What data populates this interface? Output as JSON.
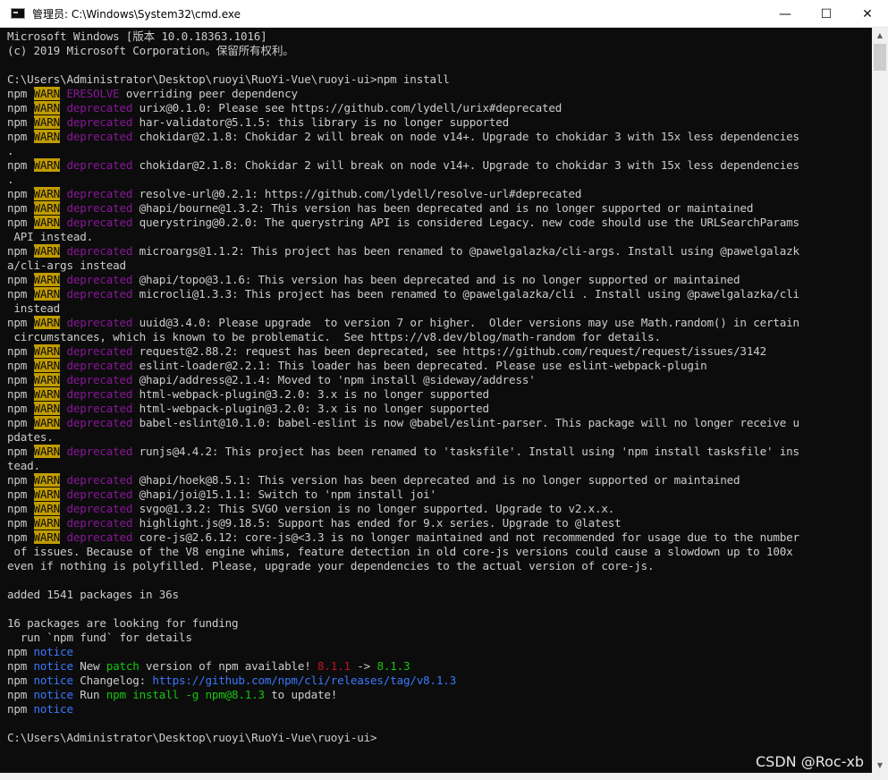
{
  "window": {
    "title": "管理员: C:\\Windows\\System32\\cmd.exe",
    "minimize": "—",
    "maximize": "☐",
    "close": "✕"
  },
  "watermark": "CSDN @Roc-xb",
  "console_lines": [
    [
      {
        "t": "Microsoft Windows [版本 10.0.18363.1016]"
      }
    ],
    [
      {
        "t": "(c) 2019 Microsoft Corporation。保留所有权利。"
      }
    ],
    [
      {
        "t": ""
      }
    ],
    [
      {
        "t": "C:\\Users\\Administrator\\Desktop\\ruoyi\\RuoYi-Vue\\ruoyi-ui>npm install"
      }
    ],
    [
      {
        "t": "npm "
      },
      {
        "t": "WARN",
        "c": "warn"
      },
      {
        "t": " "
      },
      {
        "t": "ERESOLVE",
        "c": "mag"
      },
      {
        "t": " overriding peer dependency"
      }
    ],
    [
      {
        "t": "npm "
      },
      {
        "t": "WARN",
        "c": "warn"
      },
      {
        "t": " "
      },
      {
        "t": "deprecated",
        "c": "mag"
      },
      {
        "t": " urix@0.1.0: Please see https://github.com/lydell/urix#deprecated"
      }
    ],
    [
      {
        "t": "npm "
      },
      {
        "t": "WARN",
        "c": "warn"
      },
      {
        "t": " "
      },
      {
        "t": "deprecated",
        "c": "mag"
      },
      {
        "t": " har-validator@5.1.5: this library is no longer supported"
      }
    ],
    [
      {
        "t": "npm "
      },
      {
        "t": "WARN",
        "c": "warn"
      },
      {
        "t": " "
      },
      {
        "t": "deprecated",
        "c": "mag"
      },
      {
        "t": " chokidar@2.1.8: Chokidar 2 will break on node v14+. Upgrade to chokidar 3 with 15x less dependencies"
      }
    ],
    [
      {
        "t": "."
      }
    ],
    [
      {
        "t": "npm "
      },
      {
        "t": "WARN",
        "c": "warn"
      },
      {
        "t": " "
      },
      {
        "t": "deprecated",
        "c": "mag"
      },
      {
        "t": " chokidar@2.1.8: Chokidar 2 will break on node v14+. Upgrade to chokidar 3 with 15x less dependencies"
      }
    ],
    [
      {
        "t": "."
      }
    ],
    [
      {
        "t": "npm "
      },
      {
        "t": "WARN",
        "c": "warn"
      },
      {
        "t": " "
      },
      {
        "t": "deprecated",
        "c": "mag"
      },
      {
        "t": " resolve-url@0.2.1: https://github.com/lydell/resolve-url#deprecated"
      }
    ],
    [
      {
        "t": "npm "
      },
      {
        "t": "WARN",
        "c": "warn"
      },
      {
        "t": " "
      },
      {
        "t": "deprecated",
        "c": "mag"
      },
      {
        "t": " @hapi/bourne@1.3.2: This version has been deprecated and is no longer supported or maintained"
      }
    ],
    [
      {
        "t": "npm "
      },
      {
        "t": "WARN",
        "c": "warn"
      },
      {
        "t": " "
      },
      {
        "t": "deprecated",
        "c": "mag"
      },
      {
        "t": " querystring@0.2.0: The querystring API is considered Legacy. new code should use the URLSearchParams"
      }
    ],
    [
      {
        "t": " API instead."
      }
    ],
    [
      {
        "t": "npm "
      },
      {
        "t": "WARN",
        "c": "warn"
      },
      {
        "t": " "
      },
      {
        "t": "deprecated",
        "c": "mag"
      },
      {
        "t": " microargs@1.1.2: This project has been renamed to @pawelgalazka/cli-args. Install using @pawelgalazk"
      }
    ],
    [
      {
        "t": "a/cli-args instead"
      }
    ],
    [
      {
        "t": "npm "
      },
      {
        "t": "WARN",
        "c": "warn"
      },
      {
        "t": " "
      },
      {
        "t": "deprecated",
        "c": "mag"
      },
      {
        "t": " @hapi/topo@3.1.6: This version has been deprecated and is no longer supported or maintained"
      }
    ],
    [
      {
        "t": "npm "
      },
      {
        "t": "WARN",
        "c": "warn"
      },
      {
        "t": " "
      },
      {
        "t": "deprecated",
        "c": "mag"
      },
      {
        "t": " microcli@1.3.3: This project has been renamed to @pawelgalazka/cli . Install using @pawelgalazka/cli"
      }
    ],
    [
      {
        "t": " instead"
      }
    ],
    [
      {
        "t": "npm "
      },
      {
        "t": "WARN",
        "c": "warn"
      },
      {
        "t": " "
      },
      {
        "t": "deprecated",
        "c": "mag"
      },
      {
        "t": " uuid@3.4.0: Please upgrade  to version 7 or higher.  Older versions may use Math.random() in certain"
      }
    ],
    [
      {
        "t": " circumstances, which is known to be problematic.  See https://v8.dev/blog/math-random for details."
      }
    ],
    [
      {
        "t": "npm "
      },
      {
        "t": "WARN",
        "c": "warn"
      },
      {
        "t": " "
      },
      {
        "t": "deprecated",
        "c": "mag"
      },
      {
        "t": " request@2.88.2: request has been deprecated, see https://github.com/request/request/issues/3142"
      }
    ],
    [
      {
        "t": "npm "
      },
      {
        "t": "WARN",
        "c": "warn"
      },
      {
        "t": " "
      },
      {
        "t": "deprecated",
        "c": "mag"
      },
      {
        "t": " eslint-loader@2.2.1: This loader has been deprecated. Please use eslint-webpack-plugin"
      }
    ],
    [
      {
        "t": "npm "
      },
      {
        "t": "WARN",
        "c": "warn"
      },
      {
        "t": " "
      },
      {
        "t": "deprecated",
        "c": "mag"
      },
      {
        "t": " @hapi/address@2.1.4: Moved to 'npm install @sideway/address'"
      }
    ],
    [
      {
        "t": "npm "
      },
      {
        "t": "WARN",
        "c": "warn"
      },
      {
        "t": " "
      },
      {
        "t": "deprecated",
        "c": "mag"
      },
      {
        "t": " html-webpack-plugin@3.2.0: 3.x is no longer supported"
      }
    ],
    [
      {
        "t": "npm "
      },
      {
        "t": "WARN",
        "c": "warn"
      },
      {
        "t": " "
      },
      {
        "t": "deprecated",
        "c": "mag"
      },
      {
        "t": " html-webpack-plugin@3.2.0: 3.x is no longer supported"
      }
    ],
    [
      {
        "t": "npm "
      },
      {
        "t": "WARN",
        "c": "warn"
      },
      {
        "t": " "
      },
      {
        "t": "deprecated",
        "c": "mag"
      },
      {
        "t": " babel-eslint@10.1.0: babel-eslint is now @babel/eslint-parser. This package will no longer receive u"
      }
    ],
    [
      {
        "t": "pdates."
      }
    ],
    [
      {
        "t": "npm "
      },
      {
        "t": "WARN",
        "c": "warn"
      },
      {
        "t": " "
      },
      {
        "t": "deprecated",
        "c": "mag"
      },
      {
        "t": " runjs@4.4.2: This project has been renamed to 'tasksfile'. Install using 'npm install tasksfile' ins"
      }
    ],
    [
      {
        "t": "tead."
      }
    ],
    [
      {
        "t": "npm "
      },
      {
        "t": "WARN",
        "c": "warn"
      },
      {
        "t": " "
      },
      {
        "t": "deprecated",
        "c": "mag"
      },
      {
        "t": " @hapi/hoek@8.5.1: This version has been deprecated and is no longer supported or maintained"
      }
    ],
    [
      {
        "t": "npm "
      },
      {
        "t": "WARN",
        "c": "warn"
      },
      {
        "t": " "
      },
      {
        "t": "deprecated",
        "c": "mag"
      },
      {
        "t": " @hapi/joi@15.1.1: Switch to 'npm install joi'"
      }
    ],
    [
      {
        "t": "npm "
      },
      {
        "t": "WARN",
        "c": "warn"
      },
      {
        "t": " "
      },
      {
        "t": "deprecated",
        "c": "mag"
      },
      {
        "t": " svgo@1.3.2: This SVGO version is no longer supported. Upgrade to v2.x.x."
      }
    ],
    [
      {
        "t": "npm "
      },
      {
        "t": "WARN",
        "c": "warn"
      },
      {
        "t": " "
      },
      {
        "t": "deprecated",
        "c": "mag"
      },
      {
        "t": " highlight.js@9.18.5: Support has ended for 9.x series. Upgrade to @latest"
      }
    ],
    [
      {
        "t": "npm "
      },
      {
        "t": "WARN",
        "c": "warn"
      },
      {
        "t": " "
      },
      {
        "t": "deprecated",
        "c": "mag"
      },
      {
        "t": " core-js@2.6.12: core-js@<3.3 is no longer maintained and not recommended for usage due to the number"
      }
    ],
    [
      {
        "t": " of issues. Because of the V8 engine whims, feature detection in old core-js versions could cause a slowdown up to 100x"
      }
    ],
    [
      {
        "t": "even if nothing is polyfilled. Please, upgrade your dependencies to the actual version of core-js."
      }
    ],
    [
      {
        "t": ""
      }
    ],
    [
      {
        "t": "added 1541 packages in 36s"
      }
    ],
    [
      {
        "t": ""
      }
    ],
    [
      {
        "t": "16 packages are looking for funding"
      }
    ],
    [
      {
        "t": "  run `npm fund` for details"
      }
    ],
    [
      {
        "t": "npm "
      },
      {
        "t": "notice",
        "c": "cyan"
      }
    ],
    [
      {
        "t": "npm "
      },
      {
        "t": "notice",
        "c": "cyan"
      },
      {
        "t": " New "
      },
      {
        "t": "patch",
        "c": "green"
      },
      {
        "t": " version of npm available! "
      },
      {
        "t": "8.1.1",
        "c": "red"
      },
      {
        "t": " -> "
      },
      {
        "t": "8.1.3",
        "c": "green"
      }
    ],
    [
      {
        "t": "npm "
      },
      {
        "t": "notice",
        "c": "cyan"
      },
      {
        "t": " Changelog: "
      },
      {
        "t": "https://github.com/npm/cli/releases/tag/v8.1.3",
        "c": "cyan"
      }
    ],
    [
      {
        "t": "npm "
      },
      {
        "t": "notice",
        "c": "cyan"
      },
      {
        "t": " Run "
      },
      {
        "t": "npm install -g npm@8.1.3",
        "c": "green"
      },
      {
        "t": " to update!"
      }
    ],
    [
      {
        "t": "npm "
      },
      {
        "t": "notice",
        "c": "cyan"
      }
    ],
    [
      {
        "t": ""
      }
    ],
    [
      {
        "t": "C:\\Users\\Administrator\\Desktop\\ruoyi\\RuoYi-Vue\\ruoyi-ui>"
      }
    ]
  ],
  "colors": {
    "console_bg": "#0c0c0c",
    "text": "#cccccc",
    "warn_bg": "#c19c00",
    "magenta": "#881798",
    "blue": "#3b78ff",
    "green": "#16c60c",
    "red": "#c50f1f"
  }
}
